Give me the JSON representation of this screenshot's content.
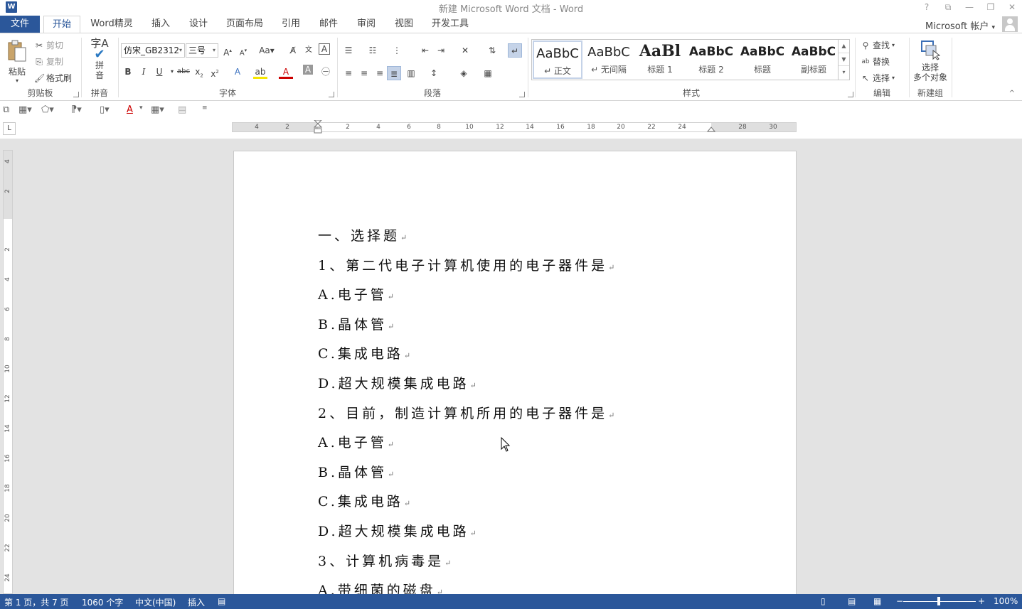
{
  "window": {
    "title": "新建 Microsoft Word 文档 - Word",
    "app_icon": "W",
    "controls": [
      "?",
      "⧉",
      "—",
      "❐",
      "✕"
    ]
  },
  "tabs": [
    {
      "label": "文件",
      "state": "file"
    },
    {
      "label": "开始",
      "state": "active"
    },
    {
      "label": "Word精灵"
    },
    {
      "label": "插入"
    },
    {
      "label": "设计"
    },
    {
      "label": "页面布局"
    },
    {
      "label": "引用"
    },
    {
      "label": "邮件"
    },
    {
      "label": "审阅"
    },
    {
      "label": "视图"
    },
    {
      "label": "开发工具"
    }
  ],
  "account": {
    "label": "Microsoft 帐户",
    "arrow": "▾"
  },
  "ribbon": {
    "clipboard": {
      "label": "剪贴板",
      "paste": "粘贴",
      "cut": "剪切",
      "copy": "复制",
      "format_painter": "格式刷"
    },
    "pinyin": {
      "label": "拼音",
      "btn_top": "拼",
      "btn_bottom": "音"
    },
    "font": {
      "label": "字体",
      "font_name": "仿宋_GB2312",
      "font_size": "三号"
    },
    "paragraph": {
      "label": "段落"
    },
    "styles": {
      "label": "样式",
      "items": [
        {
          "sample": "AaBbC",
          "name": "↵ 正文"
        },
        {
          "sample": "AaBbC",
          "name": "↵ 无间隔"
        },
        {
          "sample": "AaBl",
          "name": "标题 1"
        },
        {
          "sample": "AaBbC",
          "name": "标题 2"
        },
        {
          "sample": "AaBbC",
          "name": "标题"
        },
        {
          "sample": "AaBbC",
          "name": "副标题"
        }
      ]
    },
    "editing": {
      "label": "编辑",
      "find": "查找",
      "replace": "替换",
      "select": "选择"
    },
    "newgroup": {
      "label": "新建组",
      "btn_top": "选择",
      "btn_bottom": "多个对象"
    }
  },
  "ruler": {
    "labels": [
      "4",
      "2",
      "2",
      "4",
      "6",
      "8",
      "10",
      "12",
      "14",
      "16",
      "18",
      "20",
      "22",
      "24",
      "28",
      "30"
    ],
    "vlabels": [
      "4",
      "2",
      "2",
      "4",
      "6",
      "8",
      "10",
      "12",
      "14",
      "16",
      "18",
      "20",
      "22",
      "24"
    ],
    "tab_selector": "L"
  },
  "document": {
    "lines": [
      "一、选择题",
      "1、第二代电子计算机使用的电子器件是",
      "A.电子管",
      "B.晶体管",
      "C.集成电路",
      "D.超大规模集成电路",
      "2、目前，制造计算机所用的电子器件是",
      "A.电子管",
      "B.晶体管",
      "C.集成电路",
      "D.超大规模集成电路",
      "3、计算机病毒是",
      "A.带细菌的磁盘"
    ],
    "para_mark": "↵"
  },
  "status": {
    "page": "第 1 页，共 7 页",
    "words": "1060 个字",
    "lang": "中文(中国)",
    "mode": "插入",
    "zoom": "100%",
    "zoom_level": 1.0
  },
  "colors": {
    "accent": "#2b579a",
    "ribbon_bg": "#ffffff",
    "workspace": "#e3e3e3"
  }
}
